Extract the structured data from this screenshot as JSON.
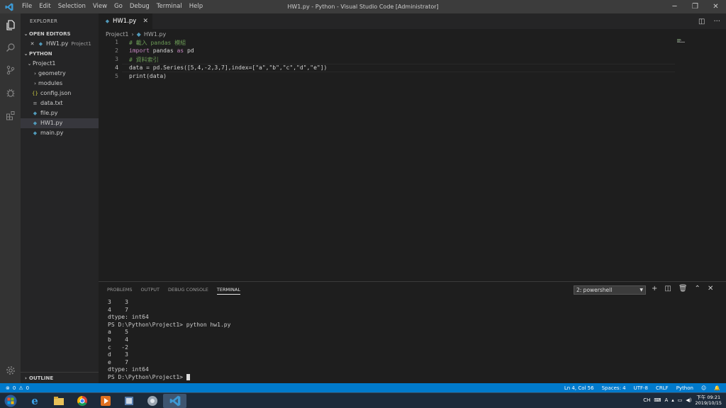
{
  "menu": [
    "File",
    "Edit",
    "Selection",
    "View",
    "Go",
    "Debug",
    "Terminal",
    "Help"
  ],
  "window_title": "HW1.py - Python - Visual Studio Code [Administrator]",
  "sidebar": {
    "header": "EXPLORER",
    "open_editors_label": "OPEN EDITORS",
    "open_editor": {
      "name": "HW1.py",
      "folder": "Project1"
    },
    "workspace_label": "PYTHON",
    "project": "Project1",
    "folders": [
      "geometry",
      "modules"
    ],
    "files": [
      "config.json",
      "data.txt",
      "file.py",
      "HW1.py",
      "main.py"
    ],
    "outline_label": "OUTLINE"
  },
  "tab": {
    "label": "HW1.py"
  },
  "breadcrumb": {
    "folder": "Project1",
    "file": "HW1.py"
  },
  "editor": {
    "line_numbers": [
      "1",
      "2",
      "3",
      "4",
      "5"
    ],
    "lines": {
      "l1": "# 載入 pandas 模組",
      "l2_kw": "import",
      "l2_mod": "pandas",
      "l2_as": "as",
      "l2_alias": "pd",
      "l3": "# 資料索引",
      "l4": "data = pd.Series([5,4,-2,3,7],index=[\"a\",\"b\",\"c\",\"d\",\"e\"])",
      "l5": "print(data)"
    }
  },
  "panel": {
    "tabs": [
      "PROBLEMS",
      "OUTPUT",
      "DEBUG CONSOLE",
      "TERMINAL"
    ],
    "active_tab": "TERMINAL",
    "shell": "2: powershell",
    "terminal_lines": [
      "3    3",
      "4    7",
      "dtype: int64",
      "PS D:\\Python\\Project1> python hw1.py",
      "a    5",
      "b    4",
      "c   -2",
      "d    3",
      "e    7",
      "dtype: int64"
    ],
    "prompt": "PS D:\\Python\\Project1> "
  },
  "status": {
    "errors": "0",
    "warnings": "0",
    "position": "Ln 4, Col 56",
    "spaces": "Spaces: 4",
    "encoding": "UTF-8",
    "eol": "CRLF",
    "language": "Python"
  },
  "taskbar": {
    "time": "下午 09:21",
    "date": "2019/10/15",
    "ime": "CH",
    "ime2": "A"
  },
  "colors": {
    "accent": "#007acc",
    "comment": "#6a9955",
    "keyword": "#c586c0"
  }
}
